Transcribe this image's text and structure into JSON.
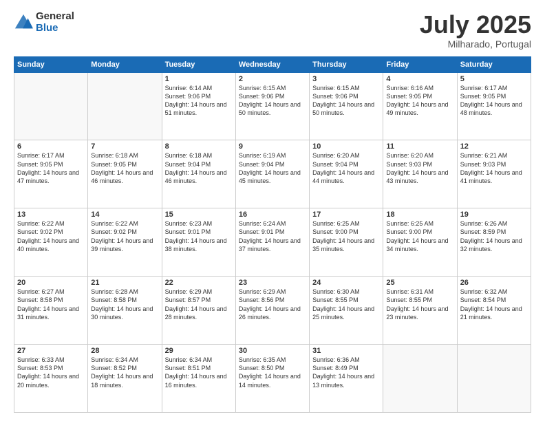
{
  "header": {
    "logo_general": "General",
    "logo_blue": "Blue",
    "month_title": "July 2025",
    "location": "Milharado, Portugal"
  },
  "weekdays": [
    "Sunday",
    "Monday",
    "Tuesday",
    "Wednesday",
    "Thursday",
    "Friday",
    "Saturday"
  ],
  "weeks": [
    [
      {
        "day": "",
        "empty": true
      },
      {
        "day": "",
        "empty": true
      },
      {
        "day": "1",
        "sunrise": "Sunrise: 6:14 AM",
        "sunset": "Sunset: 9:06 PM",
        "daylight": "Daylight: 14 hours and 51 minutes."
      },
      {
        "day": "2",
        "sunrise": "Sunrise: 6:15 AM",
        "sunset": "Sunset: 9:06 PM",
        "daylight": "Daylight: 14 hours and 50 minutes."
      },
      {
        "day": "3",
        "sunrise": "Sunrise: 6:15 AM",
        "sunset": "Sunset: 9:06 PM",
        "daylight": "Daylight: 14 hours and 50 minutes."
      },
      {
        "day": "4",
        "sunrise": "Sunrise: 6:16 AM",
        "sunset": "Sunset: 9:05 PM",
        "daylight": "Daylight: 14 hours and 49 minutes."
      },
      {
        "day": "5",
        "sunrise": "Sunrise: 6:17 AM",
        "sunset": "Sunset: 9:05 PM",
        "daylight": "Daylight: 14 hours and 48 minutes."
      }
    ],
    [
      {
        "day": "6",
        "sunrise": "Sunrise: 6:17 AM",
        "sunset": "Sunset: 9:05 PM",
        "daylight": "Daylight: 14 hours and 47 minutes."
      },
      {
        "day": "7",
        "sunrise": "Sunrise: 6:18 AM",
        "sunset": "Sunset: 9:05 PM",
        "daylight": "Daylight: 14 hours and 46 minutes."
      },
      {
        "day": "8",
        "sunrise": "Sunrise: 6:18 AM",
        "sunset": "Sunset: 9:04 PM",
        "daylight": "Daylight: 14 hours and 46 minutes."
      },
      {
        "day": "9",
        "sunrise": "Sunrise: 6:19 AM",
        "sunset": "Sunset: 9:04 PM",
        "daylight": "Daylight: 14 hours and 45 minutes."
      },
      {
        "day": "10",
        "sunrise": "Sunrise: 6:20 AM",
        "sunset": "Sunset: 9:04 PM",
        "daylight": "Daylight: 14 hours and 44 minutes."
      },
      {
        "day": "11",
        "sunrise": "Sunrise: 6:20 AM",
        "sunset": "Sunset: 9:03 PM",
        "daylight": "Daylight: 14 hours and 43 minutes."
      },
      {
        "day": "12",
        "sunrise": "Sunrise: 6:21 AM",
        "sunset": "Sunset: 9:03 PM",
        "daylight": "Daylight: 14 hours and 41 minutes."
      }
    ],
    [
      {
        "day": "13",
        "sunrise": "Sunrise: 6:22 AM",
        "sunset": "Sunset: 9:02 PM",
        "daylight": "Daylight: 14 hours and 40 minutes."
      },
      {
        "day": "14",
        "sunrise": "Sunrise: 6:22 AM",
        "sunset": "Sunset: 9:02 PM",
        "daylight": "Daylight: 14 hours and 39 minutes."
      },
      {
        "day": "15",
        "sunrise": "Sunrise: 6:23 AM",
        "sunset": "Sunset: 9:01 PM",
        "daylight": "Daylight: 14 hours and 38 minutes."
      },
      {
        "day": "16",
        "sunrise": "Sunrise: 6:24 AM",
        "sunset": "Sunset: 9:01 PM",
        "daylight": "Daylight: 14 hours and 37 minutes."
      },
      {
        "day": "17",
        "sunrise": "Sunrise: 6:25 AM",
        "sunset": "Sunset: 9:00 PM",
        "daylight": "Daylight: 14 hours and 35 minutes."
      },
      {
        "day": "18",
        "sunrise": "Sunrise: 6:25 AM",
        "sunset": "Sunset: 9:00 PM",
        "daylight": "Daylight: 14 hours and 34 minutes."
      },
      {
        "day": "19",
        "sunrise": "Sunrise: 6:26 AM",
        "sunset": "Sunset: 8:59 PM",
        "daylight": "Daylight: 14 hours and 32 minutes."
      }
    ],
    [
      {
        "day": "20",
        "sunrise": "Sunrise: 6:27 AM",
        "sunset": "Sunset: 8:58 PM",
        "daylight": "Daylight: 14 hours and 31 minutes."
      },
      {
        "day": "21",
        "sunrise": "Sunrise: 6:28 AM",
        "sunset": "Sunset: 8:58 PM",
        "daylight": "Daylight: 14 hours and 30 minutes."
      },
      {
        "day": "22",
        "sunrise": "Sunrise: 6:29 AM",
        "sunset": "Sunset: 8:57 PM",
        "daylight": "Daylight: 14 hours and 28 minutes."
      },
      {
        "day": "23",
        "sunrise": "Sunrise: 6:29 AM",
        "sunset": "Sunset: 8:56 PM",
        "daylight": "Daylight: 14 hours and 26 minutes."
      },
      {
        "day": "24",
        "sunrise": "Sunrise: 6:30 AM",
        "sunset": "Sunset: 8:55 PM",
        "daylight": "Daylight: 14 hours and 25 minutes."
      },
      {
        "day": "25",
        "sunrise": "Sunrise: 6:31 AM",
        "sunset": "Sunset: 8:55 PM",
        "daylight": "Daylight: 14 hours and 23 minutes."
      },
      {
        "day": "26",
        "sunrise": "Sunrise: 6:32 AM",
        "sunset": "Sunset: 8:54 PM",
        "daylight": "Daylight: 14 hours and 21 minutes."
      }
    ],
    [
      {
        "day": "27",
        "sunrise": "Sunrise: 6:33 AM",
        "sunset": "Sunset: 8:53 PM",
        "daylight": "Daylight: 14 hours and 20 minutes."
      },
      {
        "day": "28",
        "sunrise": "Sunrise: 6:34 AM",
        "sunset": "Sunset: 8:52 PM",
        "daylight": "Daylight: 14 hours and 18 minutes."
      },
      {
        "day": "29",
        "sunrise": "Sunrise: 6:34 AM",
        "sunset": "Sunset: 8:51 PM",
        "daylight": "Daylight: 14 hours and 16 minutes."
      },
      {
        "day": "30",
        "sunrise": "Sunrise: 6:35 AM",
        "sunset": "Sunset: 8:50 PM",
        "daylight": "Daylight: 14 hours and 14 minutes."
      },
      {
        "day": "31",
        "sunrise": "Sunrise: 6:36 AM",
        "sunset": "Sunset: 8:49 PM",
        "daylight": "Daylight: 14 hours and 13 minutes."
      },
      {
        "day": "",
        "empty": true
      },
      {
        "day": "",
        "empty": true
      }
    ]
  ]
}
